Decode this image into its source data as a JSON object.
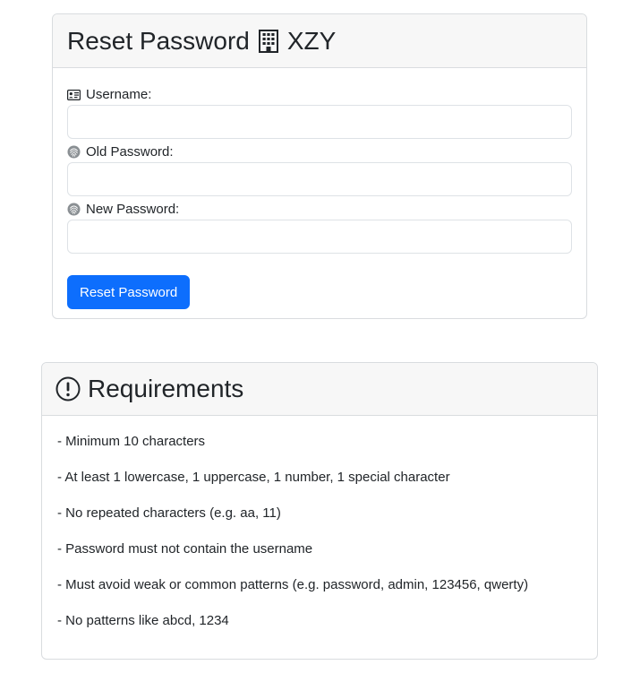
{
  "reset_form": {
    "title_prefix": "Reset Password",
    "title_suffix": "XZY",
    "title_icon": "building-icon",
    "fields": [
      {
        "label": "Username:",
        "icon": "id-card-icon",
        "value": "",
        "placeholder": ""
      },
      {
        "label": "Old Password:",
        "icon": "fingerprint-icon",
        "value": "",
        "placeholder": ""
      },
      {
        "label": "New Password:",
        "icon": "fingerprint-icon",
        "value": "",
        "placeholder": ""
      }
    ],
    "submit_label": "Reset Password"
  },
  "requirements": {
    "title": "Requirements",
    "title_icon": "exclamation-circle-icon",
    "items": [
      "- Minimum 10 characters",
      "- At least 1 lowercase, 1 uppercase, 1 number, 1 special character",
      "- No repeated characters (e.g. aa, 11)",
      "- Password must not contain the username",
      "- Must avoid weak or common patterns (e.g. password, admin, 123456, qwerty)",
      "- No patterns like abcd, 1234"
    ]
  },
  "colors": {
    "primary": "#0d6efd",
    "card_header_bg": "#f7f7f7",
    "border": "#d9dcdf",
    "text": "#212529"
  }
}
